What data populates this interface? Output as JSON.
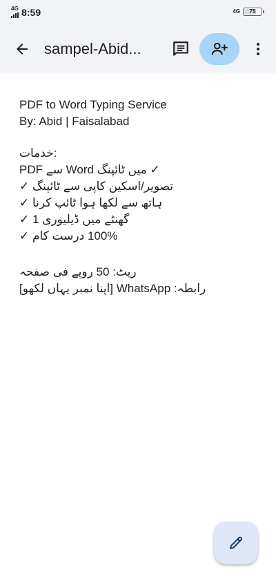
{
  "status_bar": {
    "network_left": "4G",
    "time": "8:59",
    "network_right": "4G",
    "battery": "75",
    "battery_level": 0.75
  },
  "app_bar": {
    "title": "sampel-Abid...",
    "icons": {
      "back": "arrow-back-icon",
      "comments": "comment-icon",
      "share": "person-add-icon",
      "more": "more-vert-icon"
    }
  },
  "document": {
    "heading_line1": "PDF to Word Typing Service",
    "heading_line2": "By: Abid | Faisalabad",
    "services_label": ":خدمات",
    "services": [
      "PDF سے Word میں ٹائپنگ ✓",
      "تصویر/اسکین کاپی سے ٹائپنگ ✓",
      "ہاتھ سے لکھا ہوا ٹائپ کرنا ✓",
      "گھنٹے میں ڈیلیوری 1 ✓",
      "100% درست کام ✓"
    ],
    "rate_line": "ریٹ: 50 روپے فی صفحہ",
    "contact_line": "رابطہ: WhatsApp [اپنا نمبر یہاں لکھو]"
  },
  "fab": {
    "icon": "edit-pencil-icon"
  },
  "colors": {
    "top_background": "#f1f3f7",
    "share_button": "#a8d5f5",
    "fab_background": "#dde7f7",
    "text": "#1f1f1f"
  }
}
